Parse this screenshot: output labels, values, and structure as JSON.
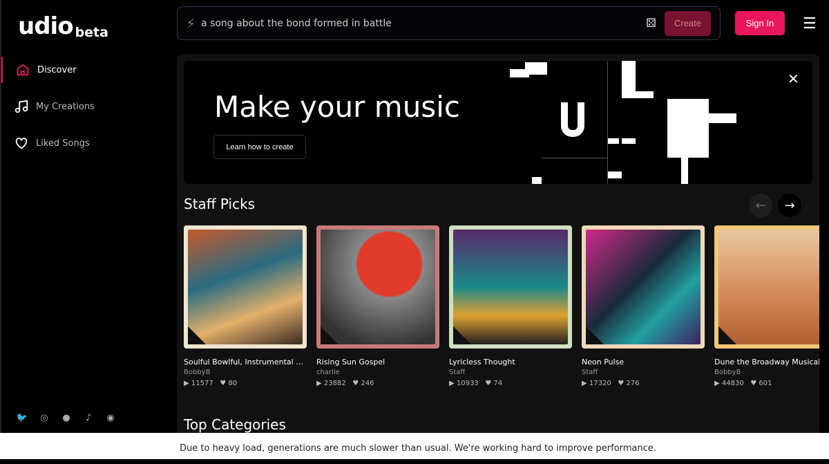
{
  "brand": {
    "name": "udio",
    "tag": "beta"
  },
  "sidebar": {
    "items": [
      {
        "label": "Discover",
        "icon": "home-icon"
      },
      {
        "label": "My Creations",
        "icon": "music-note-icon"
      },
      {
        "label": "Liked Songs",
        "icon": "heart-icon"
      }
    ],
    "social": [
      "twitter-icon",
      "instagram-icon",
      "discord-icon",
      "tiktok-icon",
      "reddit-icon"
    ]
  },
  "search": {
    "value": "a song about the bond formed in battle",
    "create_label": "Create"
  },
  "header": {
    "signin_label": "Sign In"
  },
  "banner": {
    "title": "Make your music",
    "button": "Learn how to create"
  },
  "staff_picks": {
    "title": "Staff Picks",
    "cards": [
      {
        "title": "Soulful Bowlful, Instrumental Hi...",
        "author": "BobbyB",
        "plays": "11577",
        "likes": "80"
      },
      {
        "title": "Rising Sun Gospel",
        "author": "charlie",
        "plays": "23882",
        "likes": "246"
      },
      {
        "title": "Lyricless Thought",
        "author": "Staff",
        "plays": "10933",
        "likes": "74"
      },
      {
        "title": "Neon Pulse",
        "author": "Staff",
        "plays": "17320",
        "likes": "276"
      },
      {
        "title": "Dune the Broadway Musical",
        "author": "BobbyB",
        "plays": "44830",
        "likes": "601"
      }
    ]
  },
  "top_categories": {
    "title": "Top Categories"
  },
  "notice": "Due to heavy load, generations are much slower than usual. We're working hard to improve performance.",
  "colors": {
    "accent": "#e8175d",
    "create_disabled": "#7a1232"
  }
}
